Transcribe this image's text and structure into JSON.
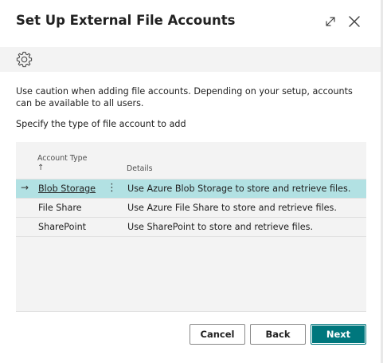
{
  "dialog": {
    "title": "Set Up External File Accounts"
  },
  "header": {
    "expand_icon": "expand-icon",
    "close_icon": "close-icon"
  },
  "toolbar": {
    "settings_icon": "gear-icon"
  },
  "body": {
    "caution_text": "Use caution when adding file accounts. Depending on your setup, accounts can be available to all users.",
    "instruction": "Specify the type of file account to add"
  },
  "grid": {
    "columns": {
      "account_type": "Account Type",
      "sort_indicator": "↑",
      "details": "Details"
    },
    "rows": [
      {
        "type": "Blob Storage",
        "details": "Use Azure Blob Storage to store and retrieve files.",
        "selected": true
      },
      {
        "type": "File Share",
        "details": "Use Azure File Share to store and retrieve files.",
        "selected": false
      },
      {
        "type": "SharePoint",
        "details": "Use SharePoint to store and retrieve files.",
        "selected": false
      }
    ],
    "row_indicator": "→",
    "row_menu": "⋮"
  },
  "actions": {
    "cancel": "Cancel",
    "back": "Back",
    "next": "Next"
  },
  "colors": {
    "accent": "#00777d",
    "selected_row": "#b2e1e3",
    "toolbar_bg": "#f3f3f3"
  }
}
